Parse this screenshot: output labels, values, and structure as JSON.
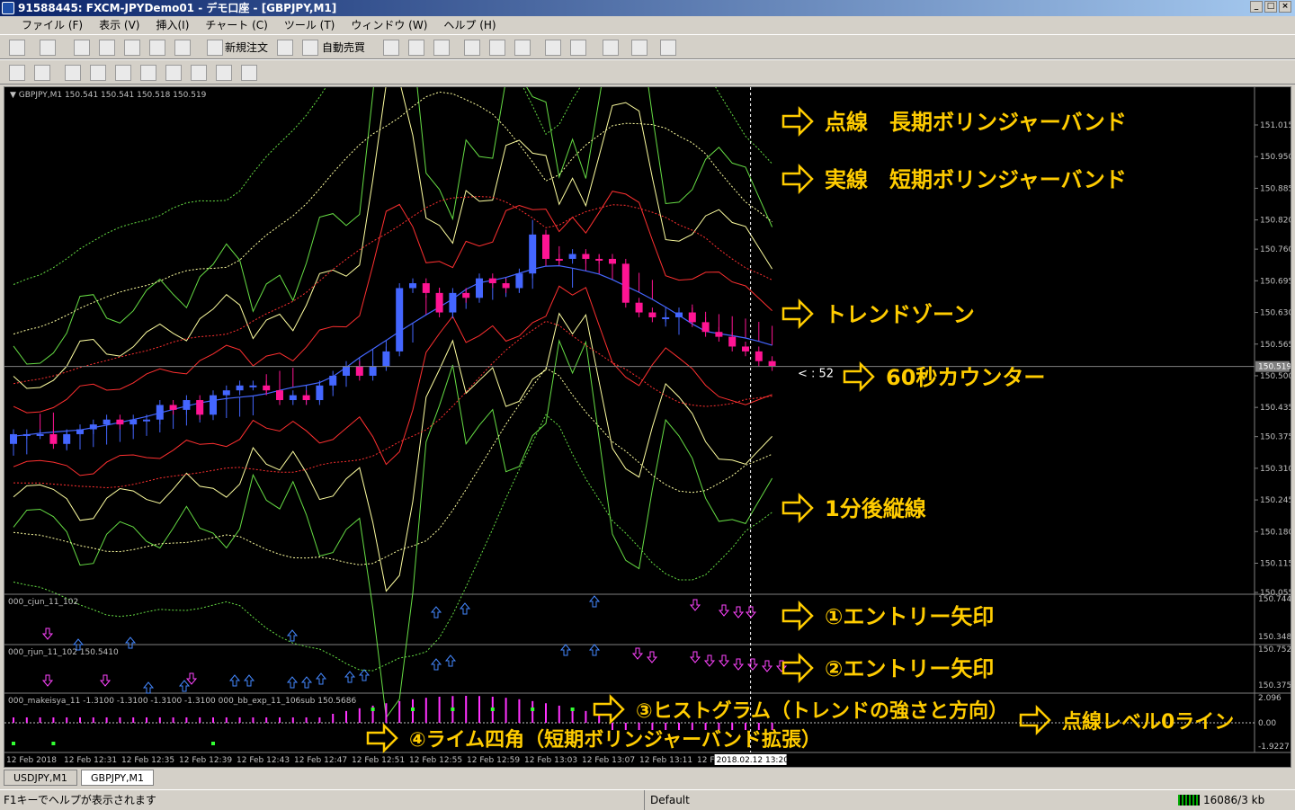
{
  "window": {
    "title": "91588445: FXCM-JPYDemo01 - デモ口座 - [GBPJPY,M1]"
  },
  "menu": [
    "ファイル (F)",
    "表示 (V)",
    "挿入(I)",
    "チャート (C)",
    "ツール (T)",
    "ウィンドウ (W)",
    "ヘルプ (H)"
  ],
  "toolbar": {
    "new_order": "新規注文",
    "auto_trade": "自動売買"
  },
  "chart_data": {
    "type": "candlestick",
    "symbol_header": "GBPJPY,M1  150.541 150.541 150.518 150.519",
    "y_ticks": [
      "151.015",
      "150.950",
      "150.885",
      "150.820",
      "150.760",
      "150.695",
      "150.630",
      "150.565",
      "150.500",
      "150.435",
      "150.375",
      "150.310",
      "150.245",
      "150.180",
      "150.115",
      "150.055"
    ],
    "current_price": "150.519",
    "ylim": [
      150.055,
      151.015
    ],
    "candles": [
      {
        "o": 150.36,
        "c": 150.38,
        "h": 150.39,
        "l": 150.35,
        "dir": "up"
      },
      {
        "o": 150.38,
        "c": 150.38,
        "h": 150.39,
        "l": 150.37,
        "dir": "up"
      },
      {
        "o": 150.38,
        "c": 150.38,
        "h": 150.39,
        "l": 150.37,
        "dir": "up"
      },
      {
        "o": 150.38,
        "c": 150.36,
        "h": 150.39,
        "l": 150.35,
        "dir": "down"
      },
      {
        "o": 150.36,
        "c": 150.38,
        "h": 150.39,
        "l": 150.35,
        "dir": "up"
      },
      {
        "o": 150.38,
        "c": 150.39,
        "h": 150.4,
        "l": 150.37,
        "dir": "up"
      },
      {
        "o": 150.39,
        "c": 150.4,
        "h": 150.41,
        "l": 150.38,
        "dir": "up"
      },
      {
        "o": 150.4,
        "c": 150.41,
        "h": 150.42,
        "l": 150.39,
        "dir": "up"
      },
      {
        "o": 150.41,
        "c": 150.4,
        "h": 150.42,
        "l": 150.39,
        "dir": "down"
      },
      {
        "o": 150.4,
        "c": 150.41,
        "h": 150.42,
        "l": 150.39,
        "dir": "up"
      },
      {
        "o": 150.41,
        "c": 150.41,
        "h": 150.42,
        "l": 150.4,
        "dir": "up"
      },
      {
        "o": 150.41,
        "c": 150.44,
        "h": 150.45,
        "l": 150.4,
        "dir": "up"
      },
      {
        "o": 150.44,
        "c": 150.43,
        "h": 150.45,
        "l": 150.42,
        "dir": "down"
      },
      {
        "o": 150.43,
        "c": 150.45,
        "h": 150.46,
        "l": 150.42,
        "dir": "up"
      },
      {
        "o": 150.45,
        "c": 150.42,
        "h": 150.46,
        "l": 150.41,
        "dir": "down"
      },
      {
        "o": 150.42,
        "c": 150.46,
        "h": 150.47,
        "l": 150.41,
        "dir": "up"
      },
      {
        "o": 150.46,
        "c": 150.47,
        "h": 150.48,
        "l": 150.45,
        "dir": "up"
      },
      {
        "o": 150.47,
        "c": 150.48,
        "h": 150.49,
        "l": 150.46,
        "dir": "up"
      },
      {
        "o": 150.48,
        "c": 150.48,
        "h": 150.49,
        "l": 150.47,
        "dir": "up"
      },
      {
        "o": 150.48,
        "c": 150.47,
        "h": 150.49,
        "l": 150.46,
        "dir": "down"
      },
      {
        "o": 150.47,
        "c": 150.45,
        "h": 150.48,
        "l": 150.44,
        "dir": "down"
      },
      {
        "o": 150.45,
        "c": 150.46,
        "h": 150.47,
        "l": 150.44,
        "dir": "up"
      },
      {
        "o": 150.46,
        "c": 150.45,
        "h": 150.47,
        "l": 150.44,
        "dir": "down"
      },
      {
        "o": 150.45,
        "c": 150.48,
        "h": 150.49,
        "l": 150.44,
        "dir": "up"
      },
      {
        "o": 150.48,
        "c": 150.5,
        "h": 150.51,
        "l": 150.47,
        "dir": "up"
      },
      {
        "o": 150.5,
        "c": 150.52,
        "h": 150.53,
        "l": 150.49,
        "dir": "up"
      },
      {
        "o": 150.52,
        "c": 150.5,
        "h": 150.53,
        "l": 150.49,
        "dir": "down"
      },
      {
        "o": 150.5,
        "c": 150.52,
        "h": 150.53,
        "l": 150.49,
        "dir": "up"
      },
      {
        "o": 150.52,
        "c": 150.55,
        "h": 150.56,
        "l": 150.51,
        "dir": "up"
      },
      {
        "o": 150.55,
        "c": 150.68,
        "h": 150.69,
        "l": 150.54,
        "dir": "up"
      },
      {
        "o": 150.68,
        "c": 150.69,
        "h": 150.7,
        "l": 150.67,
        "dir": "up"
      },
      {
        "o": 150.69,
        "c": 150.67,
        "h": 150.7,
        "l": 150.66,
        "dir": "down"
      },
      {
        "o": 150.67,
        "c": 150.63,
        "h": 150.68,
        "l": 150.62,
        "dir": "down"
      },
      {
        "o": 150.63,
        "c": 150.67,
        "h": 150.68,
        "l": 150.62,
        "dir": "up"
      },
      {
        "o": 150.67,
        "c": 150.66,
        "h": 150.68,
        "l": 150.65,
        "dir": "down"
      },
      {
        "o": 150.66,
        "c": 150.7,
        "h": 150.71,
        "l": 150.65,
        "dir": "up"
      },
      {
        "o": 150.7,
        "c": 150.69,
        "h": 150.71,
        "l": 150.68,
        "dir": "down"
      },
      {
        "o": 150.69,
        "c": 150.68,
        "h": 150.7,
        "l": 150.67,
        "dir": "down"
      },
      {
        "o": 150.68,
        "c": 150.71,
        "h": 150.72,
        "l": 150.67,
        "dir": "up"
      },
      {
        "o": 150.71,
        "c": 150.79,
        "h": 150.82,
        "l": 150.7,
        "dir": "up"
      },
      {
        "o": 150.79,
        "c": 150.74,
        "h": 150.8,
        "l": 150.73,
        "dir": "down"
      },
      {
        "o": 150.74,
        "c": 150.74,
        "h": 150.75,
        "l": 150.73,
        "dir": "down"
      },
      {
        "o": 150.74,
        "c": 150.75,
        "h": 150.76,
        "l": 150.73,
        "dir": "up"
      },
      {
        "o": 150.75,
        "c": 150.74,
        "h": 150.76,
        "l": 150.73,
        "dir": "down"
      },
      {
        "o": 150.74,
        "c": 150.74,
        "h": 150.75,
        "l": 150.73,
        "dir": "down"
      },
      {
        "o": 150.74,
        "c": 150.73,
        "h": 150.75,
        "l": 150.72,
        "dir": "down"
      },
      {
        "o": 150.73,
        "c": 150.65,
        "h": 150.74,
        "l": 150.64,
        "dir": "down"
      },
      {
        "o": 150.65,
        "c": 150.63,
        "h": 150.66,
        "l": 150.62,
        "dir": "down"
      },
      {
        "o": 150.63,
        "c": 150.62,
        "h": 150.64,
        "l": 150.61,
        "dir": "down"
      },
      {
        "o": 150.62,
        "c": 150.62,
        "h": 150.63,
        "l": 150.61,
        "dir": "up"
      },
      {
        "o": 150.62,
        "c": 150.63,
        "h": 150.64,
        "l": 150.61,
        "dir": "up"
      },
      {
        "o": 150.63,
        "c": 150.61,
        "h": 150.64,
        "l": 150.6,
        "dir": "down"
      },
      {
        "o": 150.61,
        "c": 150.59,
        "h": 150.62,
        "l": 150.58,
        "dir": "down"
      },
      {
        "o": 150.59,
        "c": 150.58,
        "h": 150.6,
        "l": 150.57,
        "dir": "down"
      },
      {
        "o": 150.58,
        "c": 150.56,
        "h": 150.59,
        "l": 150.55,
        "dir": "down"
      },
      {
        "o": 150.56,
        "c": 150.55,
        "h": 150.57,
        "l": 150.54,
        "dir": "down"
      },
      {
        "o": 150.55,
        "c": 150.53,
        "h": 150.56,
        "l": 150.52,
        "dir": "down"
      },
      {
        "o": 150.53,
        "c": 150.52,
        "h": 150.54,
        "l": 150.51,
        "dir": "down"
      }
    ],
    "counter_text": "< : 52",
    "x_ticks": [
      "12 Feb 2018",
      "12 Feb 12:31",
      "12 Feb 12:35",
      "12 Feb 12:39",
      "12 Feb 12:43",
      "12 Feb 12:47",
      "12 Feb 12:51",
      "12 Feb 12:55",
      "12 Feb 12:59",
      "12 Feb 13:03",
      "12 Feb 13:07",
      "12 Feb 13:11",
      "12 Feb 13"
    ],
    "cursor_time": "2018.02.12 13:20",
    "subwindows": [
      {
        "label": "000_cjun_11_102",
        "ticks": [
          "150.744",
          "150.348"
        ]
      },
      {
        "label": "000_rjun_11_102 150.5410",
        "ticks": [
          "150.7527",
          "150.3753"
        ]
      },
      {
        "label": "000_makeisya_11 -1.3100 -1.3100 -1.3100 -1.3100  000_bb_exp_11_106sub 150.5686",
        "ticks": [
          "2.096",
          "0.00",
          "-1.9227"
        ]
      }
    ]
  },
  "annotations": {
    "long_bb": "点線　長期ボリンジャーバンド",
    "short_bb": "実線　短期ボリンジャーバンド",
    "trend_zone": "トレンドゾーン",
    "counter": "60秒カウンター",
    "vertical": "1分後縦線",
    "entry1": "①エントリー矢印",
    "entry2": "②エントリー矢印",
    "histogram": "③ヒストグラム（トレンドの強さと方向）",
    "zero_line": "点線レベル0ライン",
    "lime": "④ライム四角（短期ボリンジャーバンド拡張）"
  },
  "tabs": [
    "USDJPY,M1",
    "GBPJPY,M1"
  ],
  "status": {
    "help": "F1キーでヘルプが表示されます",
    "profile": "Default",
    "traffic": "16086/3 kb"
  },
  "colors": {
    "bull": "#4466ff",
    "bear": "#ff1493",
    "annot": "#ffcc00",
    "bg": "#000000"
  }
}
